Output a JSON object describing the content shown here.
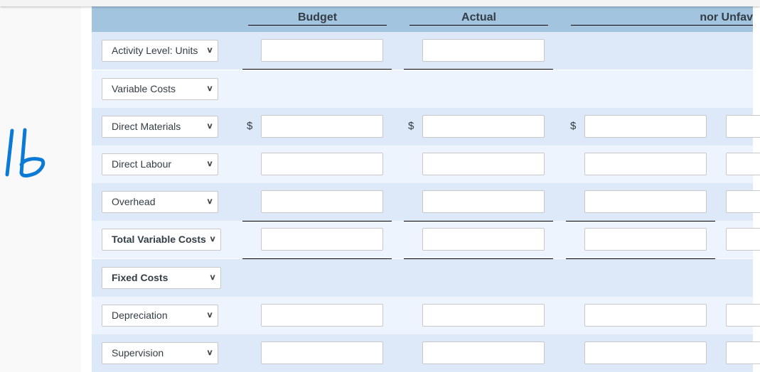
{
  "annotation": "lb",
  "header": {
    "columns": [
      "",
      "Budget",
      "Actual",
      "nor Unfav"
    ]
  },
  "currency_symbol": "$",
  "colors": {
    "header_bg": "#a3c4de",
    "row_dark": "#dde9f8",
    "row_light": "#edf4fe",
    "ink": "#0a7ad6"
  },
  "rows": [
    {
      "label": "Activity Level: Units",
      "bold": false,
      "inputs": [
        true,
        true,
        false,
        false
      ],
      "dollar": false
    },
    {
      "label": "Variable Costs",
      "bold": false,
      "inputs": [
        false,
        false,
        false,
        false
      ],
      "dollar": false
    },
    {
      "label": "Direct Materials",
      "bold": false,
      "inputs": [
        true,
        true,
        true,
        true
      ],
      "dollar": true
    },
    {
      "label": "Direct Labour",
      "bold": false,
      "inputs": [
        true,
        true,
        true,
        true
      ],
      "dollar": false
    },
    {
      "label": "Overhead",
      "bold": false,
      "inputs": [
        true,
        true,
        true,
        true
      ],
      "dollar": false
    },
    {
      "label": "Total Variable Costs",
      "bold": true,
      "inputs": [
        true,
        true,
        true,
        true
      ],
      "dollar": false
    },
    {
      "label": "Fixed Costs",
      "bold": true,
      "inputs": [
        false,
        false,
        false,
        false
      ],
      "dollar": false
    },
    {
      "label": "Depreciation",
      "bold": false,
      "inputs": [
        true,
        true,
        true,
        true
      ],
      "dollar": false
    },
    {
      "label": "Supervision",
      "bold": false,
      "inputs": [
        true,
        true,
        true,
        true
      ],
      "dollar": false
    }
  ]
}
